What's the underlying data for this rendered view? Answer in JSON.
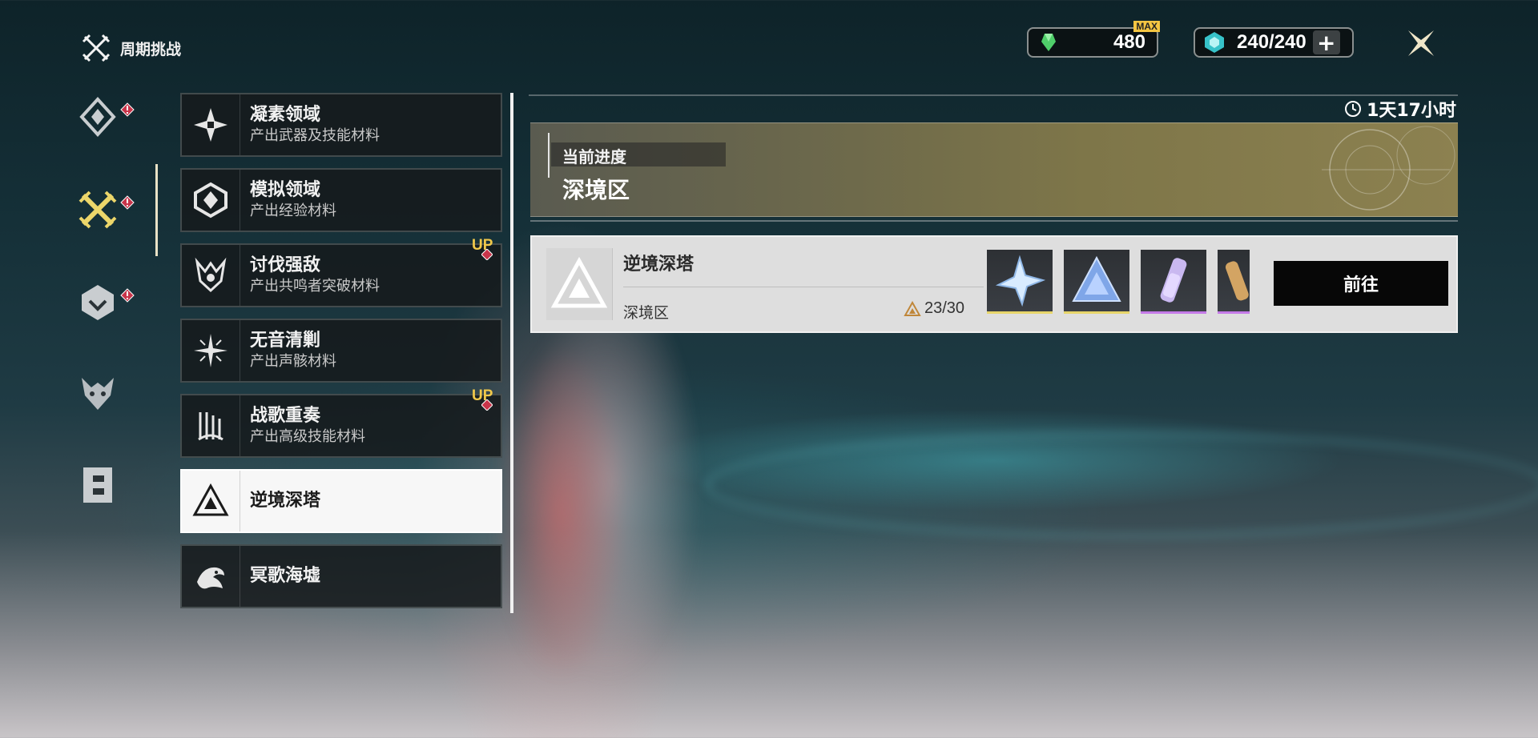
{
  "header": {
    "title": "周期挑战",
    "icon": "crossed-swords-icon"
  },
  "currency": {
    "stamina_secondary": {
      "value": "480",
      "badge": "MAX",
      "icon": "green-crystal-icon"
    },
    "stamina_primary": {
      "value": "240/240",
      "icon": "teal-crystal-icon",
      "add_label": "+"
    }
  },
  "categories": [
    {
      "name": "diamond-category-icon",
      "alert": true,
      "active": false
    },
    {
      "name": "crossed-swords-category-icon",
      "alert": true,
      "active": true
    },
    {
      "name": "hexagon-category-icon",
      "alert": true,
      "active": false
    },
    {
      "name": "demon-mask-category-icon",
      "alert": false,
      "active": false
    },
    {
      "name": "gate-category-icon",
      "alert": false,
      "active": false
    }
  ],
  "list": {
    "items": [
      {
        "name": "凝素领域",
        "desc": "产出武器及技能材料",
        "up": false,
        "active": false
      },
      {
        "name": "模拟领域",
        "desc": "产出经验材料",
        "up": false,
        "active": false
      },
      {
        "name": "讨伐强敌",
        "desc": "产出共鸣者突破材料",
        "up": true,
        "active": false
      },
      {
        "name": "无音清剿",
        "desc": "产出声骸材料",
        "up": false,
        "active": false
      },
      {
        "name": "战歌重奏",
        "desc": "产出高级技能材料",
        "up": true,
        "active": false
      },
      {
        "name": "逆境深塔",
        "desc": "",
        "up": false,
        "active": true
      },
      {
        "name": "冥歌海墟",
        "desc": "",
        "up": false,
        "active": false
      }
    ],
    "up_label": "UP"
  },
  "panel": {
    "timer": "1天17小时",
    "progress_label": "当前进度",
    "progress_value": "深境区",
    "card": {
      "name": "逆境深塔",
      "sub": "深境区",
      "count": "23/30",
      "go_label": "前往",
      "rewards": [
        {
          "icon": "star-crystal-icon",
          "rarity": "gold"
        },
        {
          "icon": "triangle-crystal-icon",
          "rarity": "gold"
        },
        {
          "icon": "vial-icon",
          "rarity": "purple"
        },
        {
          "icon": "vial-icon",
          "rarity": "purple"
        }
      ]
    }
  },
  "colors": {
    "accent_gold": "#e7d56a",
    "alert_red": "#c8344a",
    "up_yellow": "#f1c84a",
    "purple": "#c47ae8"
  }
}
